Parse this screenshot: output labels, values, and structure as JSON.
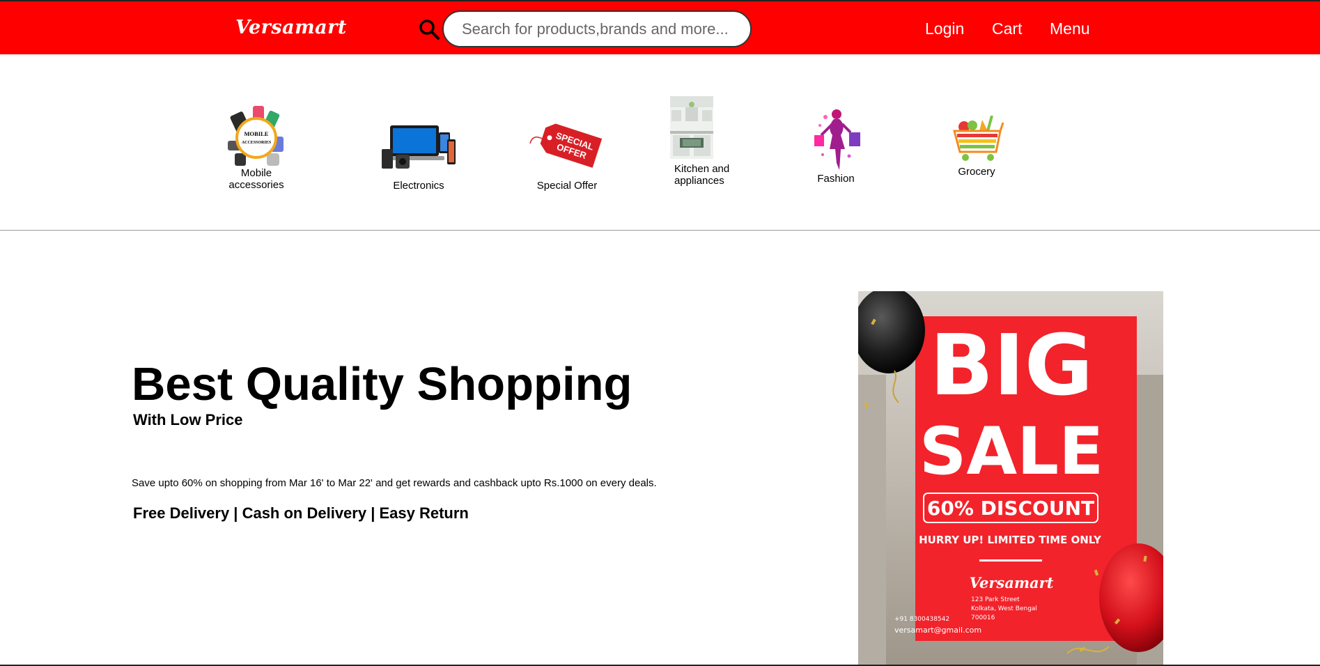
{
  "header": {
    "logo_text": "Versamart",
    "search_placeholder": "Search for products,brands and more...",
    "nav": {
      "login": "Login",
      "cart": "Cart",
      "menu": "Menu"
    },
    "bg_color": "#ff0000"
  },
  "categories": [
    {
      "label": "Mobile accessories",
      "icon": "mobile-accessories-icon"
    },
    {
      "label": "Electronics",
      "icon": "electronics-icon"
    },
    {
      "label": "Special Offer",
      "icon": "special-offer-tag-icon"
    },
    {
      "label": "Kitchen and appliances",
      "icon": "kitchen-icon"
    },
    {
      "label": "Fashion",
      "icon": "fashion-icon"
    },
    {
      "label": "Grocery",
      "icon": "grocery-cart-icon"
    }
  ],
  "hero": {
    "title": "Best Quality Shopping",
    "subtitle": "With Low Price",
    "description": "Save upto 60% on shopping from Mar 16' to Mar 22' and get rewards and cashback upto Rs.1000 on every deals.",
    "features": "Free Delivery | Cash on Delivery | Easy Return"
  },
  "banner": {
    "line1": "BIG",
    "line2": "SALE",
    "discount": "60% DISCOUNT",
    "hurry": "HURRY UP! LIMITED TIME ONLY",
    "brand": "Versamart",
    "address1": "123 Park Street",
    "address2": "Kolkata, West Bengal",
    "address3": "700016",
    "phone": "+91 8300438542",
    "email": "versamart@gmail.com",
    "accent_color": "#f2232b"
  },
  "category_texts": {
    "mobile_badge_1": "MOBILE",
    "mobile_badge_2": "ACCESSORIES",
    "tag_line1": "SPECIAL",
    "tag_line2": "OFFER"
  }
}
